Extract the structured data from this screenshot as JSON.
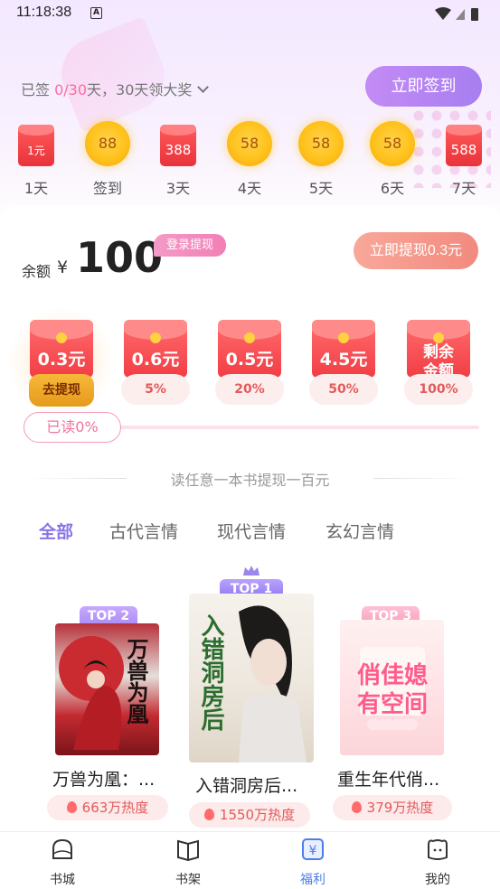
{
  "status_bar": {
    "time": "11:18:38",
    "notif": "A"
  },
  "signin": {
    "prefix": "已签",
    "count": "0/30",
    "suffix": "天，30天领大奖",
    "button": "立即签到",
    "rewards": [
      {
        "type": "envelope",
        "value": "1元",
        "day": "1天"
      },
      {
        "type": "coin",
        "value": "88",
        "day": "签到"
      },
      {
        "type": "envelope",
        "value": "388",
        "day": "3天"
      },
      {
        "type": "coin",
        "value": "58",
        "day": "4天"
      },
      {
        "type": "coin",
        "value": "58",
        "day": "5天"
      },
      {
        "type": "coin",
        "value": "58",
        "day": "6天"
      },
      {
        "type": "envelope",
        "value": "588",
        "day": "7天"
      }
    ]
  },
  "balance": {
    "label": "余额",
    "currency": "¥",
    "amount": "100",
    "login_tag": "登录提现",
    "withdraw_button": "立即提现0.3元"
  },
  "milestones": [
    {
      "amount": "0.3元",
      "pill": "去提现"
    },
    {
      "amount": "0.6元",
      "pill": "5%"
    },
    {
      "amount": "0.5元",
      "pill": "20%"
    },
    {
      "amount": "4.5元",
      "pill": "50%"
    },
    {
      "amount": "剩余\n金额",
      "pill": "100%"
    }
  ],
  "progress": {
    "read_label": "已读0%",
    "percent": 0
  },
  "promo_text": "读任意一本书提现一百元",
  "tabs": [
    "全部",
    "古代言情",
    "现代言情",
    "玄幻言情"
  ],
  "books": [
    {
      "rank": "TOP 2",
      "title": "万兽为凰：...",
      "heat": "663万热度",
      "cover_text": "万兽为凰"
    },
    {
      "rank": "TOP 1",
      "title": "入错洞房后...",
      "heat": "1550万热度",
      "cover_text": "入错洞房后"
    },
    {
      "rank": "TOP 3",
      "title": "重生年代俏...",
      "heat": "379万热度",
      "cover_text": "俏佳媳有空间"
    }
  ],
  "bottom_nav": [
    {
      "label": "书城",
      "icon": "home-icon"
    },
    {
      "label": "书架",
      "icon": "book-icon"
    },
    {
      "label": "福利",
      "icon": "yuan-icon",
      "active": true
    },
    {
      "label": "我的",
      "icon": "profile-icon"
    }
  ],
  "colors": {
    "accent": "#8a73e6",
    "pink": "#ff6aa0",
    "red": "#f23d45",
    "nav_active": "#4d7de8"
  }
}
